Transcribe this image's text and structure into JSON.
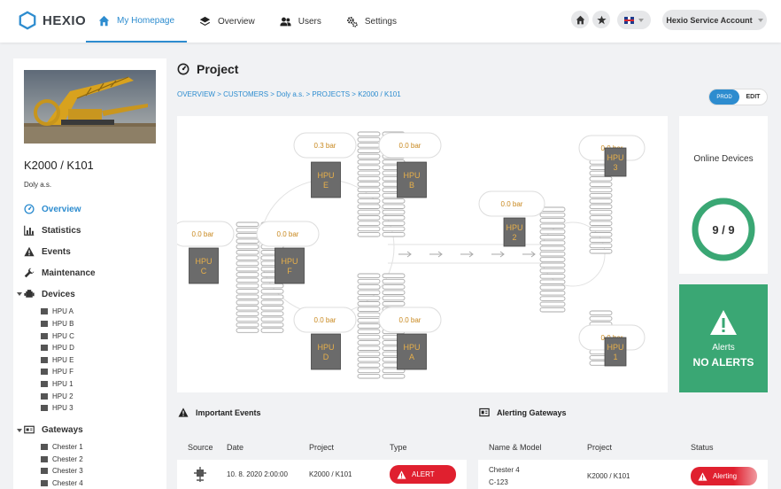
{
  "app": {
    "logo_text": "HEXIO"
  },
  "nav": {
    "tabs": [
      {
        "label": "My Homepage",
        "icon": "home-icon"
      },
      {
        "label": "Overview",
        "icon": "layers-icon"
      },
      {
        "label": "Users",
        "icon": "users-icon"
      },
      {
        "label": "Settings",
        "icon": "gears-icon"
      }
    ],
    "active_tab": "My Homepage"
  },
  "header": {
    "account_label": "Hexio Service Account",
    "language": "uk-flag-icon"
  },
  "sidebar": {
    "site_title": "K2000 / K101",
    "site_subtitle": "Doly a.s.",
    "menu": [
      {
        "label": "Overview",
        "icon": "dashboard-icon",
        "active": true
      },
      {
        "label": "Statistics",
        "icon": "bar-chart-icon"
      },
      {
        "label": "Events",
        "icon": "warning-icon"
      },
      {
        "label": "Maintenance",
        "icon": "wrench-icon"
      },
      {
        "label": "Devices",
        "icon": "engine-icon"
      },
      {
        "label": "Gateways",
        "icon": "gateway-icon"
      }
    ],
    "devices": [
      "HPU A",
      "HPU B",
      "HPU C",
      "HPU D",
      "HPU E",
      "HPU F",
      "HPU 1",
      "HPU 2",
      "HPU 3"
    ],
    "gateways": [
      "Chester 1",
      "Chester 2",
      "Chester 3",
      "Chester 4"
    ]
  },
  "main": {
    "title": "Project",
    "breadcrumb": "OVERVIEW > CUSTOMERS > Doly a.s. > PROJECTS > K2000 / K101",
    "mode_toggle": {
      "active": "PROD",
      "inactive": "EDIT"
    }
  },
  "diagram": {
    "units": [
      {
        "label_line1": "HPU",
        "label_line2": "E",
        "pressure": "0.3 bar"
      },
      {
        "label_line1": "HPU",
        "label_line2": "B",
        "pressure": "0.0 bar"
      },
      {
        "label_line1": "HPU",
        "label_line2": "C",
        "pressure": "0.0 bar"
      },
      {
        "label_line1": "HPU",
        "label_line2": "F",
        "pressure": "0.0 bar"
      },
      {
        "label_line1": "HPU",
        "label_line2": "D",
        "pressure": "0.0 bar"
      },
      {
        "label_line1": "HPU",
        "label_line2": "A",
        "pressure": "0.0 bar"
      },
      {
        "label_line1": "HPU",
        "label_line2": "2",
        "pressure": "0.0 bar"
      },
      {
        "label_line1": "HPU",
        "label_line2": "3",
        "pressure": "0.0 bar"
      },
      {
        "label_line1": "HPU",
        "label_line2": "1",
        "pressure": "0.0 bar"
      }
    ],
    "colors": {
      "unit_fill": "#6b6b6b",
      "unit_text": "#e8b04a",
      "pressure_text": "#c8881e"
    }
  },
  "online_devices": {
    "label": "Online Devices",
    "value": "9 / 9",
    "online": 9,
    "total": 9,
    "ring_color": "#3aa774"
  },
  "alerts_card": {
    "label": "Alerts",
    "value": "NO ALERTS",
    "color": "#3aa774"
  },
  "important_events": {
    "title": "Important Events",
    "columns": [
      "Source",
      "Date",
      "Project",
      "Type"
    ],
    "rows": [
      {
        "date": "10. 8. 2020 2:00:00",
        "project": "K2000 / K101",
        "type": "ALERT"
      }
    ]
  },
  "alerting_gateways": {
    "title": "Alerting Gateways",
    "columns": [
      "Name & Model",
      "Project",
      "Status"
    ],
    "rows": [
      {
        "name": "Chester 4",
        "model": "C-123",
        "project": "K2000 / K101",
        "status": "Alerting"
      }
    ]
  },
  "colors": {
    "accent": "#2d8ccf",
    "alert_red": "#e0202f",
    "ok_green": "#3aa774"
  }
}
